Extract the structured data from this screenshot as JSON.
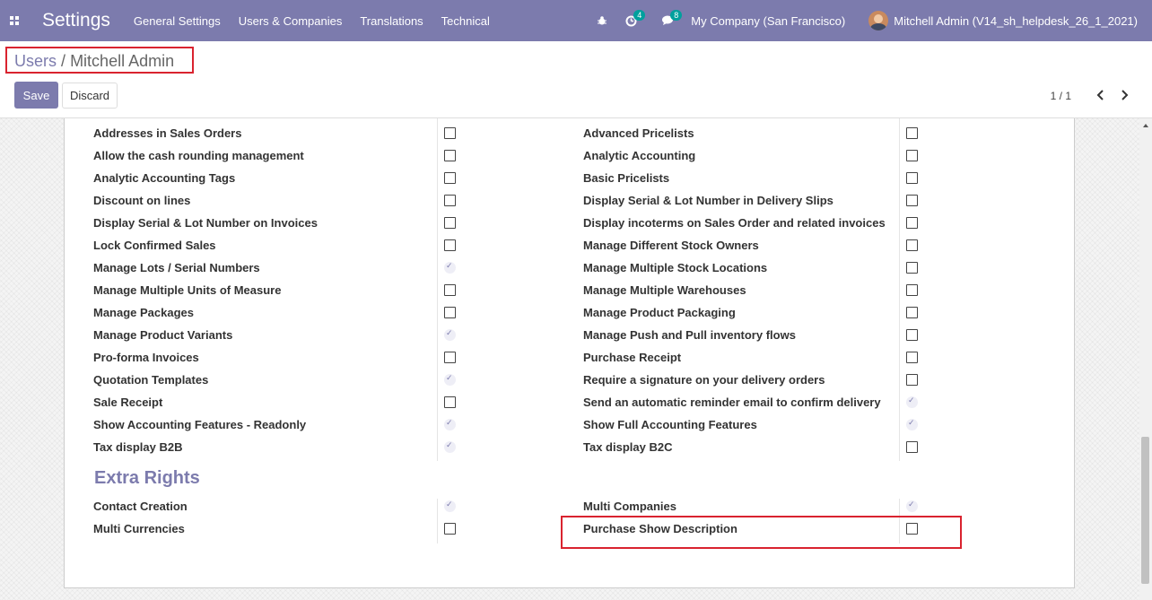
{
  "navbar": {
    "brand": "Settings",
    "menu": [
      "General Settings",
      "Users & Companies",
      "Translations",
      "Technical"
    ],
    "activity_count": "4",
    "messages_count": "8",
    "company": "My Company (San Francisco)",
    "user": "Mitchell Admin (V14_sh_helpdesk_26_1_2021)"
  },
  "breadcrumb": {
    "parent": "Users",
    "separator": "/",
    "current": "Mitchell Admin"
  },
  "buttons": {
    "save": "Save",
    "discard": "Discard"
  },
  "pager": {
    "value": "1 / 1"
  },
  "technical_settings": {
    "left": [
      {
        "label": "Addresses in Sales Orders",
        "checked": false
      },
      {
        "label": "Allow the cash rounding management",
        "checked": false
      },
      {
        "label": "Analytic Accounting Tags",
        "checked": false
      },
      {
        "label": "Discount on lines",
        "checked": false
      },
      {
        "label": "Display Serial & Lot Number on Invoices",
        "checked": false
      },
      {
        "label": "Lock Confirmed Sales",
        "checked": false
      },
      {
        "label": "Manage Lots / Serial Numbers",
        "checked": true
      },
      {
        "label": "Manage Multiple Units of Measure",
        "checked": false
      },
      {
        "label": "Manage Packages",
        "checked": false
      },
      {
        "label": "Manage Product Variants",
        "checked": true
      },
      {
        "label": "Pro-forma Invoices",
        "checked": false
      },
      {
        "label": "Quotation Templates",
        "checked": true
      },
      {
        "label": "Sale Receipt",
        "checked": false
      },
      {
        "label": "Show Accounting Features - Readonly",
        "checked": true
      },
      {
        "label": "Tax display B2B",
        "checked": true
      }
    ],
    "right": [
      {
        "label": "Advanced Pricelists",
        "checked": false
      },
      {
        "label": "Analytic Accounting",
        "checked": false
      },
      {
        "label": "Basic Pricelists",
        "checked": false
      },
      {
        "label": "Display Serial & Lot Number in Delivery Slips",
        "checked": false
      },
      {
        "label": "Display incoterms on Sales Order and related invoices",
        "checked": false
      },
      {
        "label": "Manage Different Stock Owners",
        "checked": false
      },
      {
        "label": "Manage Multiple Stock Locations",
        "checked": false
      },
      {
        "label": "Manage Multiple Warehouses",
        "checked": false
      },
      {
        "label": "Manage Product Packaging",
        "checked": false
      },
      {
        "label": "Manage Push and Pull inventory flows",
        "checked": false
      },
      {
        "label": "Purchase Receipt",
        "checked": false
      },
      {
        "label": "Require a signature on your delivery orders",
        "checked": false
      },
      {
        "label": "Send an automatic reminder email to confirm delivery",
        "checked": true
      },
      {
        "label": "Show Full Accounting Features",
        "checked": true
      },
      {
        "label": "Tax display B2C",
        "checked": false
      }
    ]
  },
  "extra_rights": {
    "title": "Extra Rights",
    "left": [
      {
        "label": "Contact Creation",
        "checked": true
      },
      {
        "label": "Multi Currencies",
        "checked": false
      }
    ],
    "right": [
      {
        "label": "Multi Companies",
        "checked": true
      },
      {
        "label": "Purchase Show Description",
        "checked": false
      }
    ]
  },
  "colors": {
    "brand": "#7c7bad",
    "highlight": "#d9232f",
    "badge": "#00a09d"
  }
}
